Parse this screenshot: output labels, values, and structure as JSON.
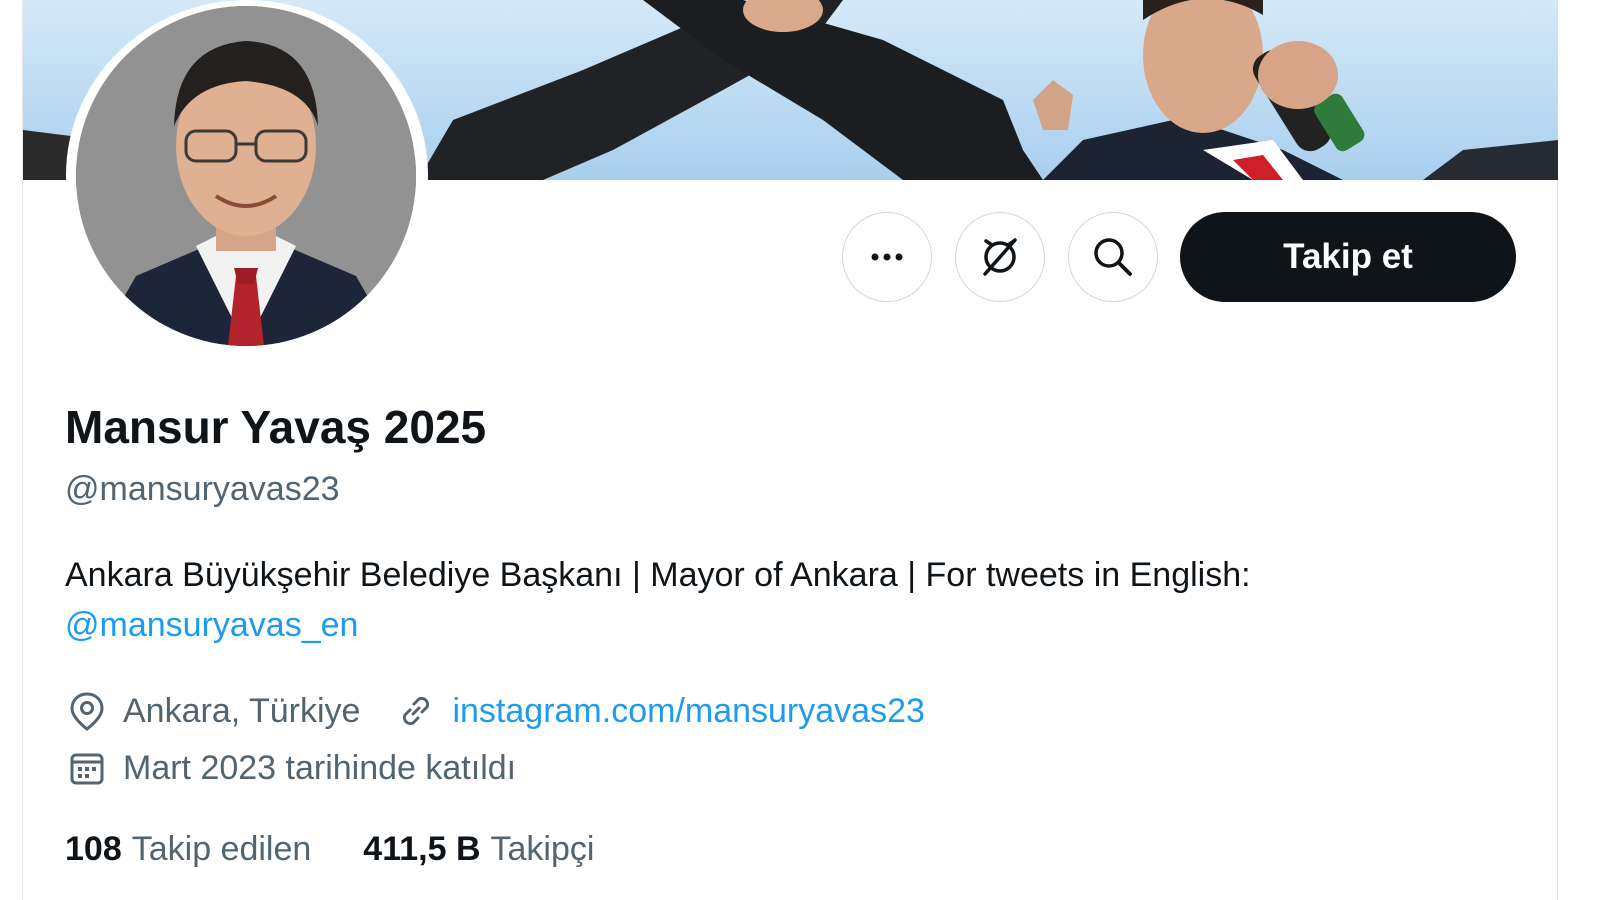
{
  "profile": {
    "display_name": "Mansur Yavaş 2025",
    "handle": "@mansuryavas23",
    "bio_text": "Ankara Büyükşehir Belediye Başkanı | Mayor of Ankara | For tweets in English:",
    "bio_mention": "@mansuryavas_en",
    "location": "Ankara, Türkiye",
    "website": "instagram.com/mansuryavas23",
    "joined": "Mart 2023 tarihinde katıldı"
  },
  "actions": {
    "more_icon": "more-icon",
    "subscribe_icon": "notifications-off-icon",
    "search_icon": "search-icon",
    "follow_label": "Takip et"
  },
  "stats": {
    "following_count": "108",
    "following_label": "Takip edilen",
    "followers_count": "411,5 B",
    "followers_label": "Takipçi"
  },
  "colors": {
    "primary_text": "#0f1419",
    "secondary_text": "#536471",
    "link": "#1d9bf0",
    "follow_button_bg": "#0f1419",
    "border": "#cfd9de"
  }
}
